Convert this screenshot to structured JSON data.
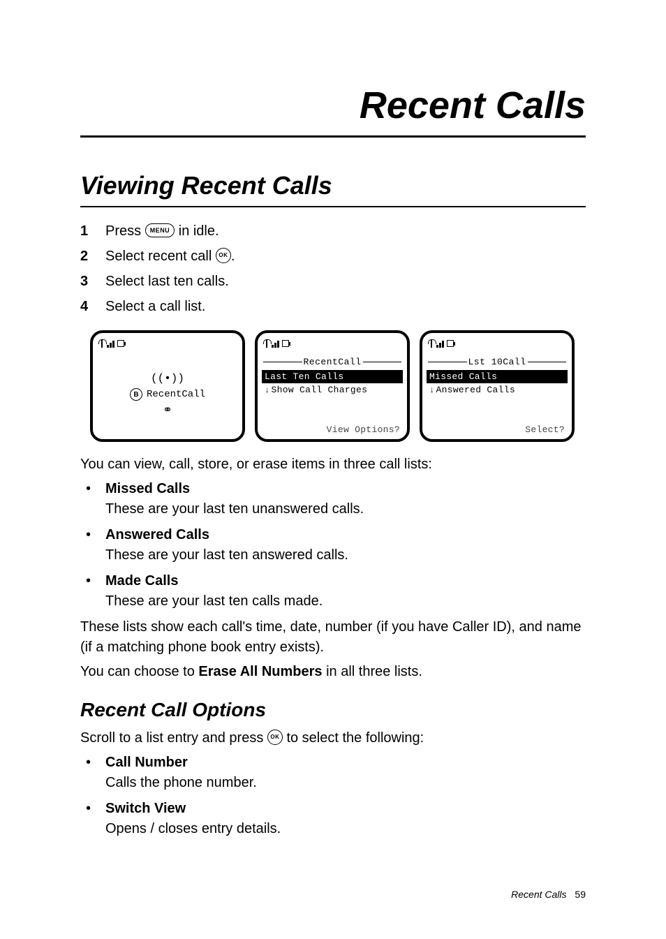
{
  "chapter": {
    "title": "Recent Calls"
  },
  "section": {
    "title": "Viewing Recent Calls"
  },
  "steps": [
    {
      "pre": "Press ",
      "icon": "MENU",
      "post": " in idle."
    },
    {
      "pre": "Select recent call ",
      "icon": "OK",
      "post": "."
    },
    {
      "pre": "Select last ten calls.",
      "icon": null,
      "post": ""
    },
    {
      "pre": "Select a call list.",
      "icon": null,
      "post": ""
    }
  ],
  "icons": {
    "menu": "MENU",
    "ok": "OK"
  },
  "screens": {
    "s1": {
      "center_label": "RecentCall"
    },
    "s2": {
      "title": "RecentCall",
      "rows": [
        "Last Ten Calls",
        "Show Call Charges"
      ],
      "selected_index": 0,
      "softkey": "View Options?"
    },
    "s3": {
      "title": "Lst 10Call",
      "rows": [
        "Missed Calls",
        "Answered Calls"
      ],
      "selected_index": 0,
      "softkey": "Select?"
    }
  },
  "intro_after_screens": "You can view, call, store, or erase items in three call lists:",
  "call_lists": [
    {
      "name": "Missed Calls",
      "desc": "These are your last ten unanswered calls."
    },
    {
      "name": "Answered Calls",
      "desc": "These are your last ten answered calls."
    },
    {
      "name": "Made Calls",
      "desc": "These are your last ten calls made."
    }
  ],
  "after_lists_1": "These lists show each call's time, date, number (if you have Caller ID), and name (if a matching phone book entry exists).",
  "after_lists_2_pre": "You can choose to ",
  "after_lists_2_bold": "Erase All Numbers",
  "after_lists_2_post": " in all three lists.",
  "sub": {
    "title": "Recent Call Options",
    "intro_pre": "Scroll to a list entry and press ",
    "intro_post": " to select the following:"
  },
  "options": [
    {
      "name": "Call Number",
      "desc": "Calls the phone number."
    },
    {
      "name": "Switch View",
      "desc": "Opens / closes entry details."
    }
  ],
  "footer": {
    "label": "Recent Calls",
    "page": "59"
  }
}
